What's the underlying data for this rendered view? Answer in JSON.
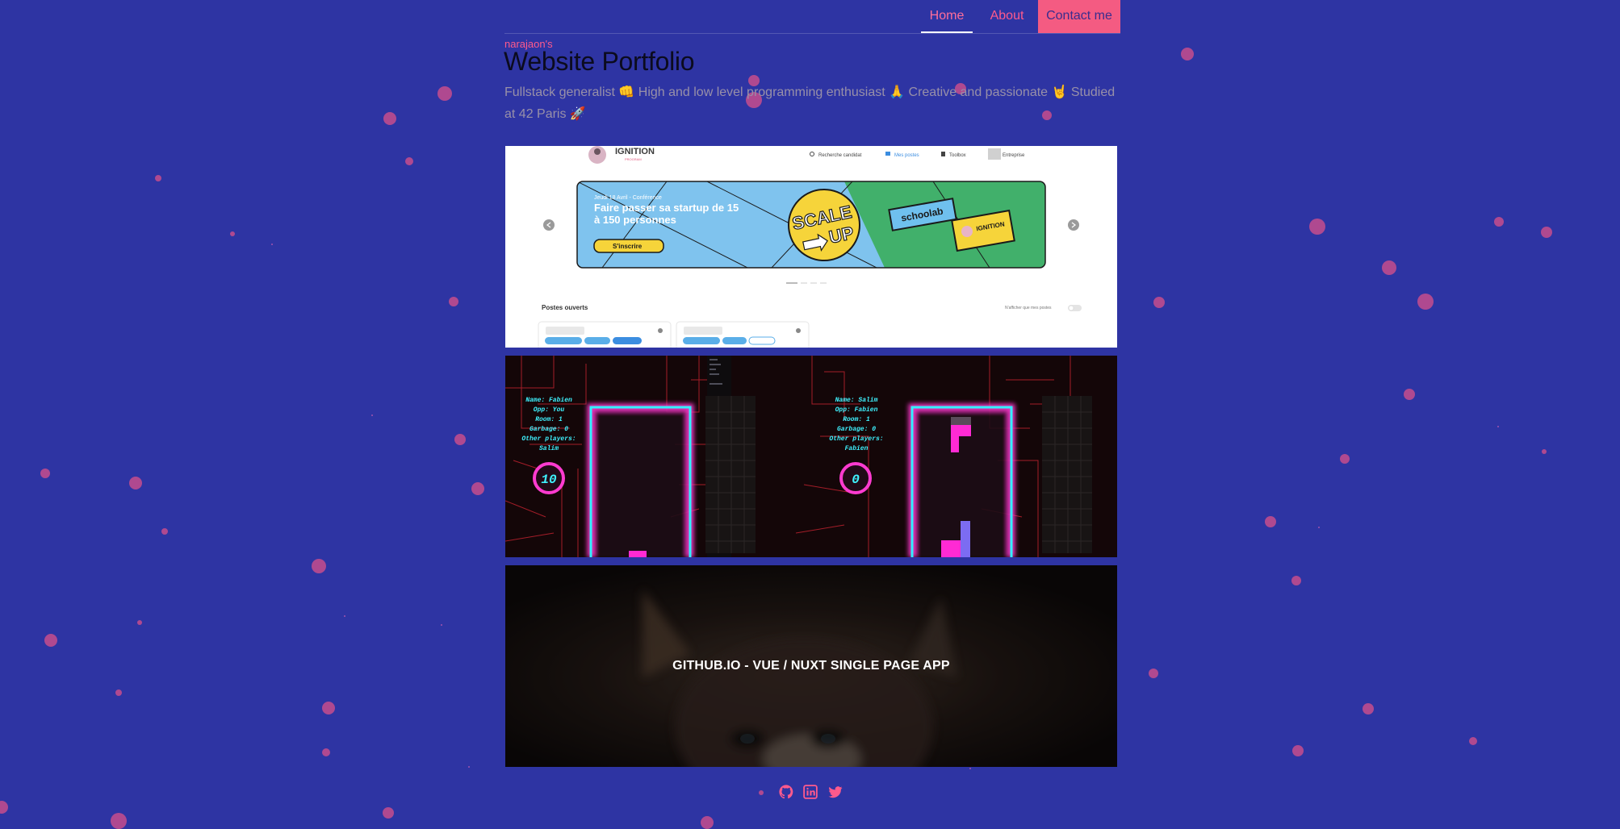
{
  "nav": {
    "home_label": "Home",
    "about_label": "About",
    "contact_label": "Contact me"
  },
  "header": {
    "eyebrow": "narajaon's",
    "title": "Website Portfolio",
    "bio": "Fullstack generalist 👊 High and low level programming enthusiast 🙏 Creative and passionate 🤘 Studied at 42 Paris 🚀"
  },
  "projects": [
    {
      "name": "ignition",
      "screenshot": {
        "logo_text": "IGNITION",
        "logo_sub": "PROGRAM",
        "menu": [
          "Recherche candidat",
          "Mes postes",
          "Toolbox",
          "Entreprise"
        ],
        "banner_date": "Jeudi 18 Avril - Conférence",
        "banner_headline_1": "Faire passer sa startup de 15",
        "banner_headline_2": "à 150 personnes",
        "banner_cta": "S'inscrire",
        "scale_up_1": "SCALE",
        "scale_up_2": "UP",
        "partner": "schoolab",
        "partner_2": "IGNITION",
        "section_title": "Postes ouverts",
        "toggle_label": "N'afficher que mes postes"
      }
    },
    {
      "name": "tetris",
      "screenshot": {
        "left_scoreboard": [
          "Name: Fabien",
          "Opp: You",
          "Room: 1",
          "Garbage: 0",
          "Other players:",
          "Salim"
        ],
        "left_score": "10",
        "right_scoreboard": [
          "Name: Salim",
          "Opp: Fabien",
          "Room: 1",
          "Garbage: 0",
          "Other players:",
          "Fabien"
        ],
        "right_score": "0"
      }
    },
    {
      "name": "github-io",
      "caption": "GITHUB.IO - VUE / NUXT SINGLE PAGE APP"
    }
  ],
  "social": {
    "icons": [
      "github-icon",
      "linkedin-icon",
      "twitter-icon"
    ]
  },
  "colors": {
    "background": "#2e34a3",
    "accent": "#ff5a8c",
    "contact_button": "#f45b82",
    "dots": "#d44f8a"
  }
}
